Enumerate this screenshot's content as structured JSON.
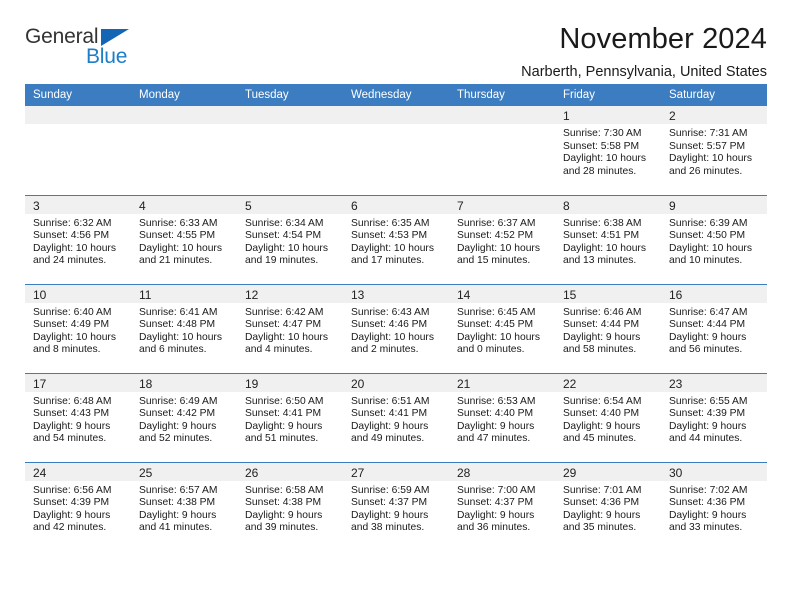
{
  "brand": {
    "name_part1": "General",
    "name_part2": "Blue",
    "accent_color": "#1d7ec8",
    "header_color": "#3b7dc0"
  },
  "header": {
    "title": "November 2024",
    "subtitle": "Narberth, Pennsylvania, United States"
  },
  "weekday_headers": [
    "Sunday",
    "Monday",
    "Tuesday",
    "Wednesday",
    "Thursday",
    "Friday",
    "Saturday"
  ],
  "weeks": [
    [
      {
        "day": "",
        "sunrise": "",
        "sunset": "",
        "daylight1": "",
        "daylight2": ""
      },
      {
        "day": "",
        "sunrise": "",
        "sunset": "",
        "daylight1": "",
        "daylight2": ""
      },
      {
        "day": "",
        "sunrise": "",
        "sunset": "",
        "daylight1": "",
        "daylight2": ""
      },
      {
        "day": "",
        "sunrise": "",
        "sunset": "",
        "daylight1": "",
        "daylight2": ""
      },
      {
        "day": "",
        "sunrise": "",
        "sunset": "",
        "daylight1": "",
        "daylight2": ""
      },
      {
        "day": "1",
        "sunrise": "Sunrise: 7:30 AM",
        "sunset": "Sunset: 5:58 PM",
        "daylight1": "Daylight: 10 hours",
        "daylight2": "and 28 minutes."
      },
      {
        "day": "2",
        "sunrise": "Sunrise: 7:31 AM",
        "sunset": "Sunset: 5:57 PM",
        "daylight1": "Daylight: 10 hours",
        "daylight2": "and 26 minutes."
      }
    ],
    [
      {
        "day": "3",
        "sunrise": "Sunrise: 6:32 AM",
        "sunset": "Sunset: 4:56 PM",
        "daylight1": "Daylight: 10 hours",
        "daylight2": "and 24 minutes."
      },
      {
        "day": "4",
        "sunrise": "Sunrise: 6:33 AM",
        "sunset": "Sunset: 4:55 PM",
        "daylight1": "Daylight: 10 hours",
        "daylight2": "and 21 minutes."
      },
      {
        "day": "5",
        "sunrise": "Sunrise: 6:34 AM",
        "sunset": "Sunset: 4:54 PM",
        "daylight1": "Daylight: 10 hours",
        "daylight2": "and 19 minutes."
      },
      {
        "day": "6",
        "sunrise": "Sunrise: 6:35 AM",
        "sunset": "Sunset: 4:53 PM",
        "daylight1": "Daylight: 10 hours",
        "daylight2": "and 17 minutes."
      },
      {
        "day": "7",
        "sunrise": "Sunrise: 6:37 AM",
        "sunset": "Sunset: 4:52 PM",
        "daylight1": "Daylight: 10 hours",
        "daylight2": "and 15 minutes."
      },
      {
        "day": "8",
        "sunrise": "Sunrise: 6:38 AM",
        "sunset": "Sunset: 4:51 PM",
        "daylight1": "Daylight: 10 hours",
        "daylight2": "and 13 minutes."
      },
      {
        "day": "9",
        "sunrise": "Sunrise: 6:39 AM",
        "sunset": "Sunset: 4:50 PM",
        "daylight1": "Daylight: 10 hours",
        "daylight2": "and 10 minutes."
      }
    ],
    [
      {
        "day": "10",
        "sunrise": "Sunrise: 6:40 AM",
        "sunset": "Sunset: 4:49 PM",
        "daylight1": "Daylight: 10 hours",
        "daylight2": "and 8 minutes."
      },
      {
        "day": "11",
        "sunrise": "Sunrise: 6:41 AM",
        "sunset": "Sunset: 4:48 PM",
        "daylight1": "Daylight: 10 hours",
        "daylight2": "and 6 minutes."
      },
      {
        "day": "12",
        "sunrise": "Sunrise: 6:42 AM",
        "sunset": "Sunset: 4:47 PM",
        "daylight1": "Daylight: 10 hours",
        "daylight2": "and 4 minutes."
      },
      {
        "day": "13",
        "sunrise": "Sunrise: 6:43 AM",
        "sunset": "Sunset: 4:46 PM",
        "daylight1": "Daylight: 10 hours",
        "daylight2": "and 2 minutes."
      },
      {
        "day": "14",
        "sunrise": "Sunrise: 6:45 AM",
        "sunset": "Sunset: 4:45 PM",
        "daylight1": "Daylight: 10 hours",
        "daylight2": "and 0 minutes."
      },
      {
        "day": "15",
        "sunrise": "Sunrise: 6:46 AM",
        "sunset": "Sunset: 4:44 PM",
        "daylight1": "Daylight: 9 hours",
        "daylight2": "and 58 minutes."
      },
      {
        "day": "16",
        "sunrise": "Sunrise: 6:47 AM",
        "sunset": "Sunset: 4:44 PM",
        "daylight1": "Daylight: 9 hours",
        "daylight2": "and 56 minutes."
      }
    ],
    [
      {
        "day": "17",
        "sunrise": "Sunrise: 6:48 AM",
        "sunset": "Sunset: 4:43 PM",
        "daylight1": "Daylight: 9 hours",
        "daylight2": "and 54 minutes."
      },
      {
        "day": "18",
        "sunrise": "Sunrise: 6:49 AM",
        "sunset": "Sunset: 4:42 PM",
        "daylight1": "Daylight: 9 hours",
        "daylight2": "and 52 minutes."
      },
      {
        "day": "19",
        "sunrise": "Sunrise: 6:50 AM",
        "sunset": "Sunset: 4:41 PM",
        "daylight1": "Daylight: 9 hours",
        "daylight2": "and 51 minutes."
      },
      {
        "day": "20",
        "sunrise": "Sunrise: 6:51 AM",
        "sunset": "Sunset: 4:41 PM",
        "daylight1": "Daylight: 9 hours",
        "daylight2": "and 49 minutes."
      },
      {
        "day": "21",
        "sunrise": "Sunrise: 6:53 AM",
        "sunset": "Sunset: 4:40 PM",
        "daylight1": "Daylight: 9 hours",
        "daylight2": "and 47 minutes."
      },
      {
        "day": "22",
        "sunrise": "Sunrise: 6:54 AM",
        "sunset": "Sunset: 4:40 PM",
        "daylight1": "Daylight: 9 hours",
        "daylight2": "and 45 minutes."
      },
      {
        "day": "23",
        "sunrise": "Sunrise: 6:55 AM",
        "sunset": "Sunset: 4:39 PM",
        "daylight1": "Daylight: 9 hours",
        "daylight2": "and 44 minutes."
      }
    ],
    [
      {
        "day": "24",
        "sunrise": "Sunrise: 6:56 AM",
        "sunset": "Sunset: 4:39 PM",
        "daylight1": "Daylight: 9 hours",
        "daylight2": "and 42 minutes."
      },
      {
        "day": "25",
        "sunrise": "Sunrise: 6:57 AM",
        "sunset": "Sunset: 4:38 PM",
        "daylight1": "Daylight: 9 hours",
        "daylight2": "and 41 minutes."
      },
      {
        "day": "26",
        "sunrise": "Sunrise: 6:58 AM",
        "sunset": "Sunset: 4:38 PM",
        "daylight1": "Daylight: 9 hours",
        "daylight2": "and 39 minutes."
      },
      {
        "day": "27",
        "sunrise": "Sunrise: 6:59 AM",
        "sunset": "Sunset: 4:37 PM",
        "daylight1": "Daylight: 9 hours",
        "daylight2": "and 38 minutes."
      },
      {
        "day": "28",
        "sunrise": "Sunrise: 7:00 AM",
        "sunset": "Sunset: 4:37 PM",
        "daylight1": "Daylight: 9 hours",
        "daylight2": "and 36 minutes."
      },
      {
        "day": "29",
        "sunrise": "Sunrise: 7:01 AM",
        "sunset": "Sunset: 4:36 PM",
        "daylight1": "Daylight: 9 hours",
        "daylight2": "and 35 minutes."
      },
      {
        "day": "30",
        "sunrise": "Sunrise: 7:02 AM",
        "sunset": "Sunset: 4:36 PM",
        "daylight1": "Daylight: 9 hours",
        "daylight2": "and 33 minutes."
      }
    ]
  ]
}
